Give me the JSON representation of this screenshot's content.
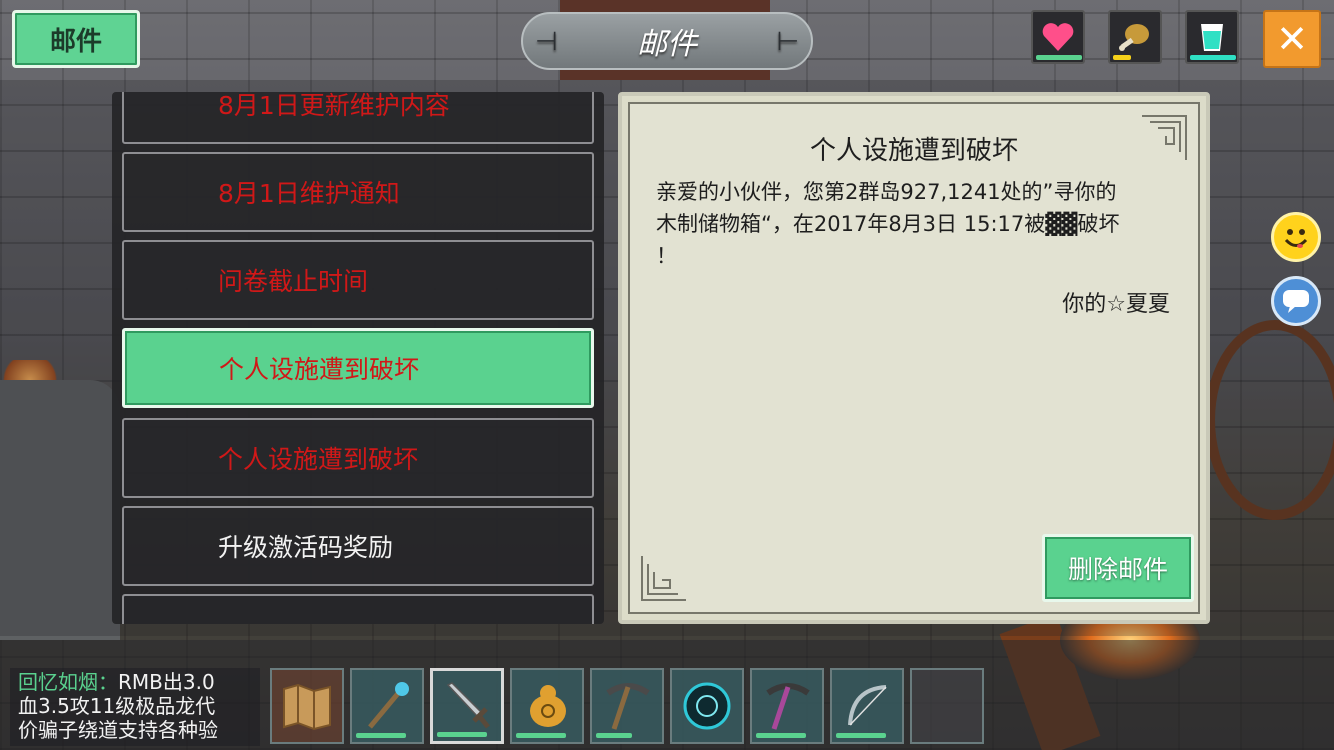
{
  "header": {
    "tab_label": "邮件",
    "title": "邮件"
  },
  "stats": {
    "health": {
      "icon": "heart-icon",
      "color": "#ff4f8a",
      "bar_color": "#5ad28f",
      "level": 1.0
    },
    "hunger": {
      "icon": "drumstick-icon",
      "color": "#c79a3a",
      "bar_color": "#f5d01a",
      "level": 0.4
    },
    "thirst": {
      "icon": "cup-icon",
      "color": "#2fe0c4",
      "bar_color": "#2fe0c4",
      "level": 1.0
    }
  },
  "mail": {
    "items": [
      {
        "label": "8月1日更新维护内容",
        "style": "red"
      },
      {
        "label": "8月1日维护通知",
        "style": "red"
      },
      {
        "label": "问卷截止时间",
        "style": "red"
      },
      {
        "label": "个人设施遭到破坏",
        "style": "red",
        "selected": true
      },
      {
        "label": "个人设施遭到破坏",
        "style": "red"
      },
      {
        "label": "升级激活码奖励",
        "style": "white"
      }
    ],
    "detail": {
      "subject": "个人设施遭到破坏",
      "body_line1": "亲爱的小伙伴，您第2群岛927,1241处的”寻你的",
      "body_line2": "木制储物箱“，在2017年8月3日  15:17被▓▓破坏",
      "body_line3": "！",
      "signature": "你的☆夏夏",
      "delete_label": "删除邮件"
    }
  },
  "chat": {
    "name": "回忆如烟：",
    "line1_rest": "RMB出3.0",
    "line2": "血3.5攻11级极品龙代",
    "line3": "价骗子绕道支持各种验"
  },
  "hotbar": [
    {
      "icon": "map-icon"
    },
    {
      "icon": "staff-icon",
      "durability": 1.0
    },
    {
      "icon": "sword-icon",
      "durability": 1.0,
      "active": true
    },
    {
      "icon": "gourd-icon",
      "durability": 1.0
    },
    {
      "icon": "pickaxe-icon",
      "durability": 0.7
    },
    {
      "icon": "orb-icon"
    },
    {
      "icon": "purple-pickaxe-icon",
      "durability": 1.0
    },
    {
      "icon": "bow-icon",
      "durability": 1.0
    },
    {
      "icon": "empty-slot"
    }
  ]
}
